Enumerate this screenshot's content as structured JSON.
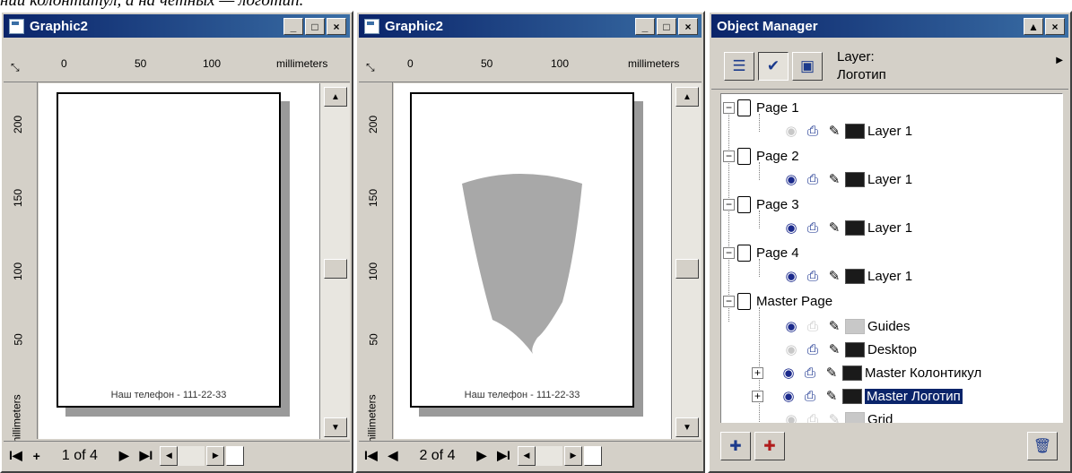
{
  "caption": "ний колонтитул, а на четных — логотип.",
  "window1": {
    "title": "Graphic2",
    "ruler_top": [
      "0",
      "50",
      "100",
      "millimeters"
    ],
    "ruler_left": [
      "200",
      "150",
      "100",
      "50",
      "millimeters"
    ],
    "footer": "Наш телефон - 111-22-33",
    "page_count": "1 of 4",
    "nav": {
      "first": "I◀",
      "add": "+",
      "next": "▶",
      "last": "▶I"
    }
  },
  "window2": {
    "title": "Graphic2",
    "ruler_top": [
      "0",
      "50",
      "100",
      "millimeters"
    ],
    "ruler_left": [
      "200",
      "150",
      "100",
      "50",
      "millimeters"
    ],
    "footer": "Наш телефон - 111-22-33",
    "page_count": "2 of 4",
    "nav": {
      "first": "I◀",
      "prev": "◀",
      "next": "▶",
      "last": "▶I"
    }
  },
  "object_manager": {
    "title": "Object Manager",
    "layer_label": "Layer:",
    "layer_name": "Логотип",
    "tree": {
      "page1": "Page 1",
      "page1_layer": "Layer 1",
      "page2": "Page 2",
      "page2_layer": "Layer 1",
      "page3": "Page 3",
      "page3_layer": "Layer 1",
      "page4": "Page 4",
      "page4_layer": "Layer 1",
      "master": "Master Page",
      "guides": "Guides",
      "desktop": "Desktop",
      "kolontitul": "Master Колонтикул",
      "logotip": "Master Логотип",
      "grid": "Grid"
    }
  },
  "window_buttons": {
    "minimize": "_",
    "maximize": "□",
    "close": "×"
  },
  "colors": {
    "titlebar": "#0a246a",
    "shield": "#a8a8a8",
    "selected": "#0a246a",
    "swatch_dark": "#1a1a1a",
    "swatch_light": "#c8c8c8"
  }
}
